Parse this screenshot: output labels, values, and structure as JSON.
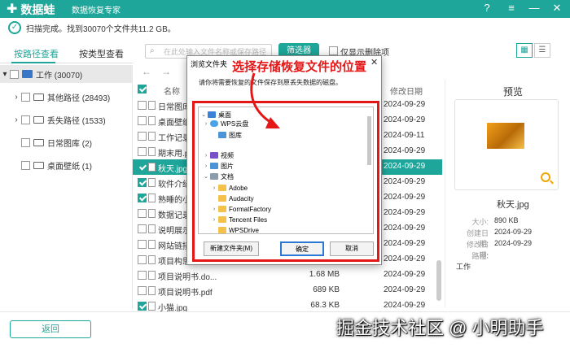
{
  "app": {
    "name": "数据蛙",
    "subtitle": "数据恢复专家",
    "brand_color": "#1da699"
  },
  "status": {
    "text": "扫描完成。找到30070个文件共11.2 GB。"
  },
  "tabs": [
    {
      "label": "按路径查看",
      "active": true
    },
    {
      "label": "按类型查看",
      "active": false
    }
  ],
  "toolbar": {
    "search_placeholder": "在此处输入文件名称或保存路径",
    "filter_label": "筛选器",
    "show_deleted_label": "仅显示删除项"
  },
  "tree": [
    {
      "label": "工作 (30070)",
      "selected": true
    },
    {
      "label": "其他路径 (28493)"
    },
    {
      "label": "丢失路径 (1533)"
    },
    {
      "label": "日常图库 (2)"
    },
    {
      "label": "桌面壁纸 (1)"
    }
  ],
  "list": {
    "col_name": "名称",
    "col_date": "修改日期",
    "rows": [
      {
        "name": "日常图库",
        "size": "",
        "date": "2024-09-29",
        "checked": false
      },
      {
        "name": "桌面壁纸",
        "size": "",
        "date": "2024-09-29",
        "checked": false
      },
      {
        "name": "工作记录1",
        "size": "",
        "date": "2024-09-11",
        "checked": false
      },
      {
        "name": "期末用.ppt",
        "size": "",
        "date": "2024-09-29",
        "checked": false
      },
      {
        "name": "秋天.jpg",
        "size": "",
        "date": "2024-09-29",
        "checked": true,
        "selected": true
      },
      {
        "name": "软件介绍",
        "size": "",
        "date": "2024-09-29",
        "checked": true
      },
      {
        "name": "熟睡的小猫",
        "size": "",
        "date": "2024-09-29",
        "checked": true
      },
      {
        "name": "数据记录",
        "size": "",
        "date": "2024-09-29",
        "checked": false
      },
      {
        "name": "说明展示.p",
        "size": "",
        "date": "2024-09-29",
        "checked": false
      },
      {
        "name": "网站链接.t",
        "size": "",
        "date": "2024-09-29",
        "checked": false
      },
      {
        "name": "项目构思.docx",
        "size": "",
        "date": "2024-09-29",
        "checked": false
      },
      {
        "name": "项目说明书.do...",
        "size": "1.68 MB",
        "date": "2024-09-29",
        "checked": false
      },
      {
        "name": "项目说明书.pdf",
        "size": "689 KB",
        "date": "2024-09-29",
        "checked": false
      },
      {
        "name": "小猫.jpg",
        "size": "68.3 KB",
        "date": "2024-09-29",
        "checked": true
      }
    ]
  },
  "preview": {
    "title": "预览",
    "file_name": "秋天.jpg",
    "size_label": "大小:",
    "size_value": "890 KB",
    "created_label": "创建日期:",
    "created_value": "2024-09-29",
    "modified_label": "修改日期:",
    "modified_value": "2024-09-29",
    "path_label": "路径:",
    "path_value": "工作"
  },
  "footer": {
    "back_label": "返回"
  },
  "dialog": {
    "title": "浏览文件夹",
    "description": "请你将需要恢复的文件保存到原丢失数据的磁盘。",
    "annotation": "选择存储恢复文件的位置",
    "new_folder_label": "新建文件夹(M)",
    "ok_label": "确定",
    "cancel_label": "取消",
    "tree": [
      {
        "label": "桌面",
        "icon": "desktop-icon"
      },
      {
        "label": "WPS云盘",
        "icon": "cloud-icon"
      },
      {
        "label": "图库",
        "icon": "gallery-icon"
      },
      {
        "label": "视频",
        "icon": "video-icon"
      },
      {
        "label": "图片",
        "icon": "picture-icon"
      },
      {
        "label": "文档",
        "icon": "document-icon"
      },
      {
        "label": "Adobe",
        "icon": "folder-icon"
      },
      {
        "label": "Audacity",
        "icon": "folder-icon"
      },
      {
        "label": "FormatFactory",
        "icon": "folder-icon"
      },
      {
        "label": "Tencent Files",
        "icon": "folder-icon"
      },
      {
        "label": "WPSDrive",
        "icon": "folder-icon"
      }
    ]
  },
  "watermark": "掘金技术社区 @ 小明助手"
}
